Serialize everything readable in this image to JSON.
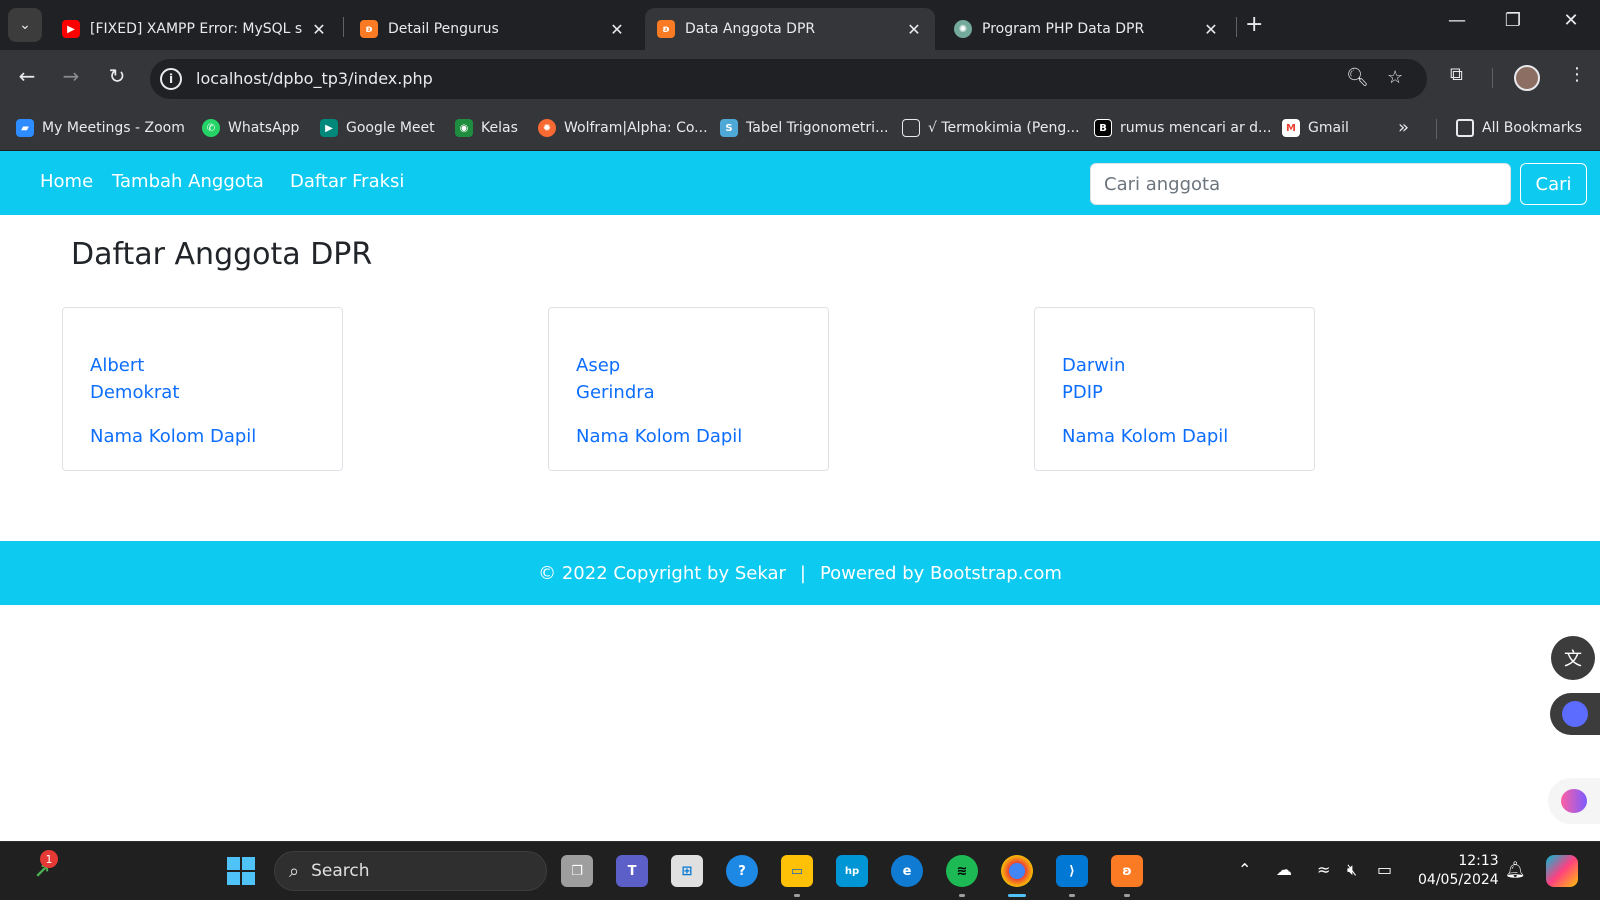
{
  "browser": {
    "tabs": [
      {
        "title": "[FIXED] XAMPP Error: MySQL sh",
        "favicon": "youtube-icon",
        "color": "#ff0000"
      },
      {
        "title": "Detail Pengurus",
        "favicon": "xampp-icon",
        "color": "#fb7a24"
      },
      {
        "title": "Data Anggota DPR",
        "favicon": "xampp-icon",
        "color": "#fb7a24",
        "active": true
      },
      {
        "title": "Program PHP Data DPR",
        "favicon": "chatgpt-icon",
        "color": "#74aa9c"
      }
    ],
    "url": "localhost/dpbo_tp3/index.php",
    "bookmarks": [
      {
        "label": "My Meetings - Zoom",
        "icon": "zoom-icon",
        "color": "#2d8cff"
      },
      {
        "label": "WhatsApp",
        "icon": "whatsapp-icon",
        "color": "#25d366"
      },
      {
        "label": "Google Meet",
        "icon": "google-meet-icon",
        "color": "#00897b"
      },
      {
        "label": "Kelas",
        "icon": "google-classroom-icon",
        "color": "#1e8e3e"
      },
      {
        "label": "Wolfram|Alpha: Co...",
        "icon": "wolfram-icon",
        "color": "#f96932"
      },
      {
        "label": "Tabel Trigonometri...",
        "icon": "s-icon",
        "color": "#4fa9d6"
      },
      {
        "label": "√ Termokimia (Peng...",
        "icon": "book-icon",
        "color": "#5f6368"
      },
      {
        "label": "rumus mencari ar d...",
        "icon": "b-icon",
        "color": "#000000"
      },
      {
        "label": "Gmail",
        "icon": "gmail-icon",
        "color": "#ea4335"
      }
    ],
    "all_bookmarks": "All Bookmarks"
  },
  "site": {
    "nav": [
      "Home",
      "Tambah Anggota",
      "Daftar Fraksi"
    ],
    "search_placeholder": "Cari anggota",
    "search_button": "Cari",
    "title": "Daftar Anggota DPR",
    "members": [
      {
        "name": "Albert",
        "party": "Demokrat",
        "dapil": "Nama Kolom Dapil"
      },
      {
        "name": "Asep",
        "party": "Gerindra",
        "dapil": "Nama Kolom Dapil"
      },
      {
        "name": "Darwin",
        "party": "PDIP",
        "dapil": "Nama Kolom Dapil"
      }
    ],
    "footer_left": "© 2022 Copyright by Sekar",
    "footer_sep": "|",
    "footer_right": "Powered by Bootstrap.com",
    "accent_color": "#0dcaf0",
    "link_color": "#0d6efd"
  },
  "taskbar": {
    "search_label": "Search",
    "notification_count": "1",
    "time": "12:13",
    "date": "04/05/2024"
  }
}
